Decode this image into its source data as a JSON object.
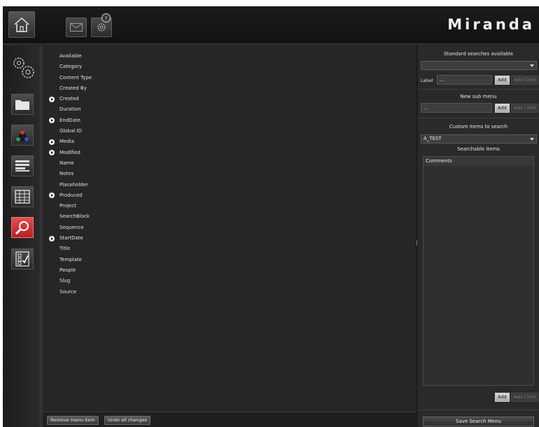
{
  "brand": {
    "logo_text": "Miranda"
  },
  "topbar": {
    "home_icon": "home-icon",
    "mail_icon": "mail-icon",
    "settings_icon": "gear-icon",
    "settings_badge": "!"
  },
  "sidebar": {
    "items": [
      {
        "icon": "gears-icon",
        "active": false
      },
      {
        "icon": "folder-icon",
        "active": false
      },
      {
        "icon": "color-triangle-icon",
        "active": false
      },
      {
        "icon": "list-icon",
        "active": false
      },
      {
        "icon": "grid-icon",
        "active": false
      },
      {
        "icon": "search-icon",
        "active": true
      },
      {
        "icon": "checklist-icon",
        "active": false
      }
    ]
  },
  "available": {
    "items": [
      {
        "label": "Available",
        "expandable": false
      },
      {
        "label": "Category",
        "expandable": false
      },
      {
        "label": "Content Type",
        "expandable": false
      },
      {
        "label": "Created By",
        "expandable": false
      },
      {
        "label": "Created",
        "expandable": true
      },
      {
        "label": "Duration",
        "expandable": false
      },
      {
        "label": "EndDate",
        "expandable": true
      },
      {
        "label": "Global ID",
        "expandable": false
      },
      {
        "label": "Media",
        "expandable": true
      },
      {
        "label": "Modified",
        "expandable": true
      },
      {
        "label": "Name",
        "expandable": false
      },
      {
        "label": "Notes",
        "expandable": false
      },
      {
        "label": "Placeholder",
        "expandable": false
      },
      {
        "label": "Produced",
        "expandable": true
      },
      {
        "label": "Project",
        "expandable": false
      },
      {
        "label": "SearchBlock",
        "expandable": false
      },
      {
        "label": "Sequence",
        "expandable": false
      },
      {
        "label": "StartDate",
        "expandable": true
      },
      {
        "label": "Title",
        "expandable": false
      },
      {
        "label": "Template",
        "expandable": false
      },
      {
        "label": "People",
        "expandable": false
      },
      {
        "label": "Slug",
        "expandable": false
      },
      {
        "label": "Source",
        "expandable": false
      }
    ],
    "remove_label": "Remove menu item",
    "undo_label": "Undo all changes"
  },
  "right": {
    "standard_header": "Standard searches available",
    "standard_select_value": "",
    "label_caption": "Label",
    "label_value": "...",
    "add_label": "Add",
    "add_child_label": "Add Child",
    "submenu_header": "New sub menu",
    "submenu_value": "...",
    "custom_header": "Custom items to search",
    "custom_select_value": "A_TEST",
    "searchable_header": "Searchable Items",
    "searchable_items": [
      "Comments"
    ],
    "save_label": "Save Search Menu"
  }
}
